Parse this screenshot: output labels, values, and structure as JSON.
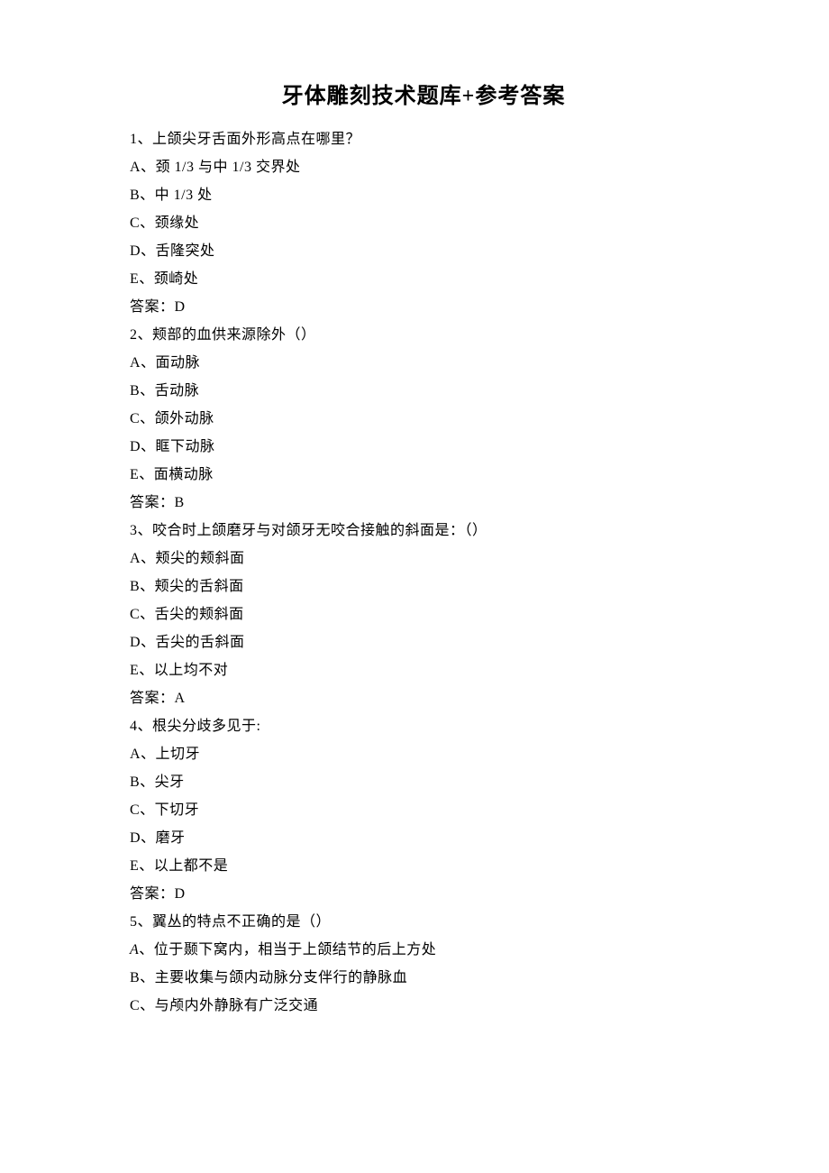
{
  "title": "牙体雕刻技术题库+参考答案",
  "lines": [
    "1、上颌尖牙舌面外形高点在哪里？",
    "A、颈 1/3 与中 1/3 交界处",
    "B、中 1/3 处",
    "C、颈缘处",
    "D、舌隆突处",
    "E、颈崎处",
    "答案：D",
    "2、颊部的血供来源除外（）",
    "A、面动脉",
    "B、舌动脉",
    "C、颌外动脉",
    "D、眶下动脉",
    "E、面横动脉",
    "答案：B",
    "3、咬合时上颌磨牙与对颌牙无咬合接触的斜面是：（）",
    "A、颊尖的颊斜面",
    "B、颊尖的舌斜面",
    "C、舌尖的颊斜面",
    "D、舌尖的舌斜面",
    "E、以上均不对",
    "答案：A",
    "4、根尖分歧多见于:",
    "A、上切牙",
    "B、尖牙",
    "C、下切牙",
    "D、磨牙",
    "E、以上都不是",
    "答案：D",
    "5、翼丛的特点不正确的是（）",
    "A、位于颞下窝内，相当于上颌结节的后上方处",
    "B、主要收集与颌内动脉分支伴行的静脉血",
    "C、与颅内外静脉有广泛交通"
  ],
  "special_line_index": 29
}
